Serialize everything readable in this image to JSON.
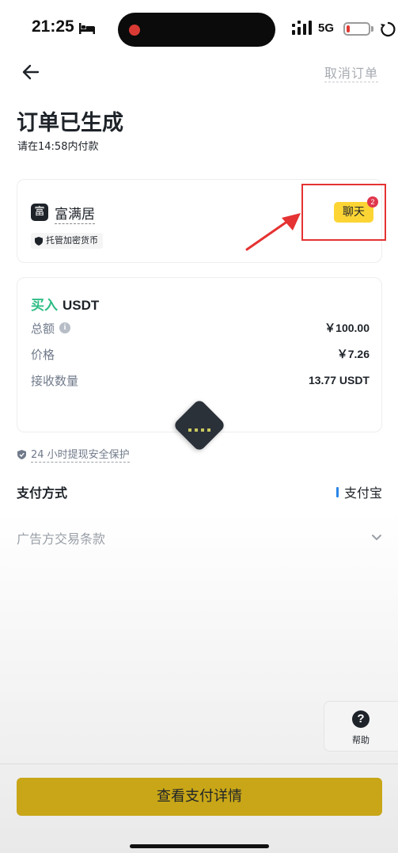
{
  "status_bar": {
    "time": "21:25",
    "network": "5G",
    "battery_level": 0.15
  },
  "header": {
    "cancel_label": "取消订单"
  },
  "title": "订单已生成",
  "deadline": "请在14:58内付款",
  "merchant": {
    "avatar_char": "富",
    "name": "富满居",
    "escrow_label": "托管加密货币",
    "chat_label": "聊天",
    "chat_badge": "2"
  },
  "order": {
    "side": "买入",
    "asset": "USDT",
    "rows": [
      {
        "label": "总额",
        "value": "￥100.00"
      },
      {
        "label": "价格",
        "value": "￥7.26"
      },
      {
        "label": "接收数量",
        "value": "13.77 USDT"
      }
    ]
  },
  "protection": "24 小时提现安全保护",
  "payment": {
    "label": "支付方式",
    "value": "支付宝"
  },
  "terms_label": "广告方交易条款",
  "help": {
    "icon": "?",
    "label": "帮助"
  },
  "primary_button": "查看支付详情",
  "colors": {
    "buy": "#2ebd85",
    "accent": "#fcd535",
    "button": "#c8a617",
    "badge": "#e0364c",
    "annotation": "#e53232",
    "alipay": "#2a86e6"
  }
}
